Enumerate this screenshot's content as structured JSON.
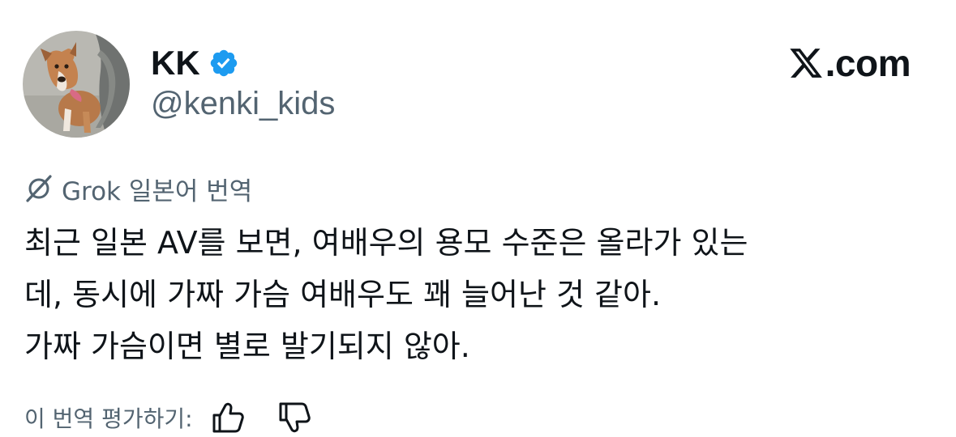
{
  "author": {
    "display_name": "KK",
    "handle": "@kenki_kids",
    "verified": true
  },
  "site": {
    "suffix": ".com"
  },
  "translation": {
    "label": "Grok 일본어 번역"
  },
  "tweet": {
    "lines": [
      "최근 일본 AV를 보면, 여배우의 용모 수준은 올라가 있는",
      "데, 동시에 가짜 가슴 여배우도 꽤 늘어난 것 같아.",
      "가짜 가슴이면 별로 발기되지 않아."
    ]
  },
  "rating": {
    "label": "이 번역 평가하기:"
  },
  "icons": {
    "verified": "verified-badge-icon",
    "logo": "x-logo-icon",
    "grok": "grok-icon",
    "thumbs_up": "thumbs-up-icon",
    "thumbs_down": "thumbs-down-icon"
  },
  "colors": {
    "text_primary": "#0f1419",
    "text_secondary": "#536471",
    "verified_blue": "#1d9bf0",
    "background": "#ffffff"
  }
}
